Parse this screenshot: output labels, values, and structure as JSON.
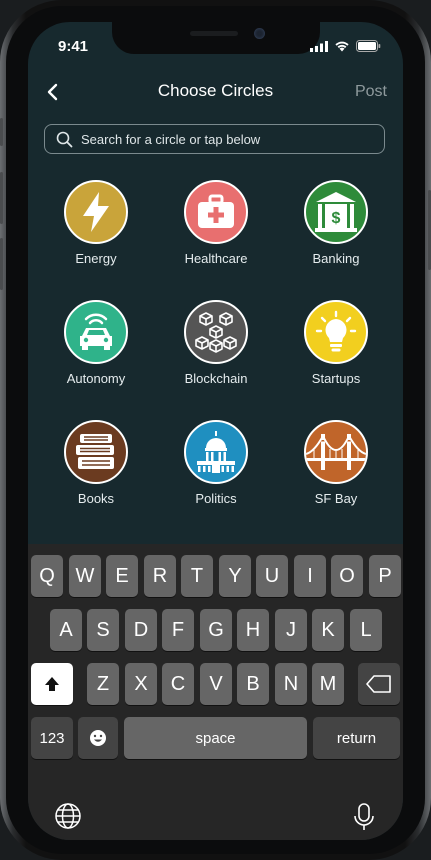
{
  "status_bar": {
    "time": "9:41"
  },
  "nav": {
    "title": "Choose Circles",
    "post_label": "Post"
  },
  "search": {
    "placeholder": "Search for a circle or tap below"
  },
  "circles": [
    {
      "label": "Energy",
      "color": "#c9a43a",
      "icon": "lightning-icon"
    },
    {
      "label": "Healthcare",
      "color": "#e86f6f",
      "icon": "first-aid-kit-icon"
    },
    {
      "label": "Banking",
      "color": "#2e8b3a",
      "icon": "bank-icon"
    },
    {
      "label": "Autonomy",
      "color": "#2fb38a",
      "icon": "autonomous-car-icon"
    },
    {
      "label": "Blockchain",
      "color": "#555555",
      "icon": "blockchain-cubes-icon"
    },
    {
      "label": "Startups",
      "color": "#f2cf1f",
      "icon": "lightbulb-icon"
    },
    {
      "label": "Books",
      "color": "#6b3b20",
      "icon": "books-icon"
    },
    {
      "label": "Politics",
      "color": "#1f8fc0",
      "icon": "capitol-icon"
    },
    {
      "label": "SF Bay",
      "color": "#c0652a",
      "icon": "golden-gate-bridge-icon"
    }
  ],
  "keyboard": {
    "row1": [
      "Q",
      "W",
      "E",
      "R",
      "T",
      "Y",
      "U",
      "I",
      "O",
      "P"
    ],
    "row2": [
      "A",
      "S",
      "D",
      "F",
      "G",
      "H",
      "J",
      "K",
      "L"
    ],
    "row3": [
      "Z",
      "X",
      "C",
      "V",
      "B",
      "N",
      "M"
    ],
    "numbers_label": "123",
    "space_label": "space",
    "return_label": "return"
  }
}
